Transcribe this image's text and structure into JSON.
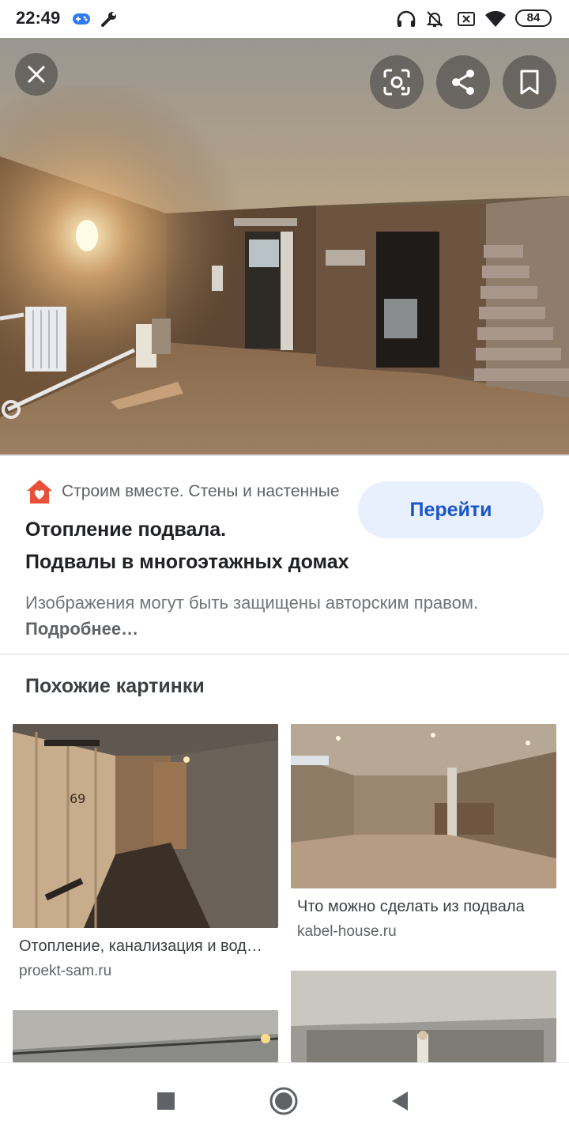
{
  "status_bar": {
    "time": "22:49",
    "battery": "84",
    "icons": [
      "gamepad-icon",
      "wrench-icon",
      "headphones-icon",
      "notifications-off-icon",
      "sim-off-icon",
      "wifi-icon",
      "battery-icon"
    ]
  },
  "viewer": {
    "close_icon": "close-icon",
    "actions": [
      "lens-icon",
      "share-icon",
      "bookmark-icon"
    ]
  },
  "result": {
    "source": "Строим вместе. Стены и настенные",
    "title_line1": "Отопление подвала.",
    "title_line2": "Подвалы в многоэтажных домах",
    "visit_label": "Перейти",
    "copyright_text": "Изображения могут быть защищены авторским правом.",
    "more_label": "Подробнее…"
  },
  "related": {
    "heading": "Похожие картинки",
    "cards": [
      {
        "title": "Отопление, канализация и водопровод",
        "domain": "proekt-sam.ru"
      },
      {
        "title": "Что можно сделать из подвала",
        "domain": "kabel-house.ru"
      }
    ]
  },
  "nav_bar": {
    "icons": [
      "recents-icon",
      "home-icon",
      "back-icon"
    ]
  },
  "colors": {
    "accent": "#1a56c8",
    "button_bg": "#e8f0fe",
    "source_logo": "#e8503a"
  }
}
